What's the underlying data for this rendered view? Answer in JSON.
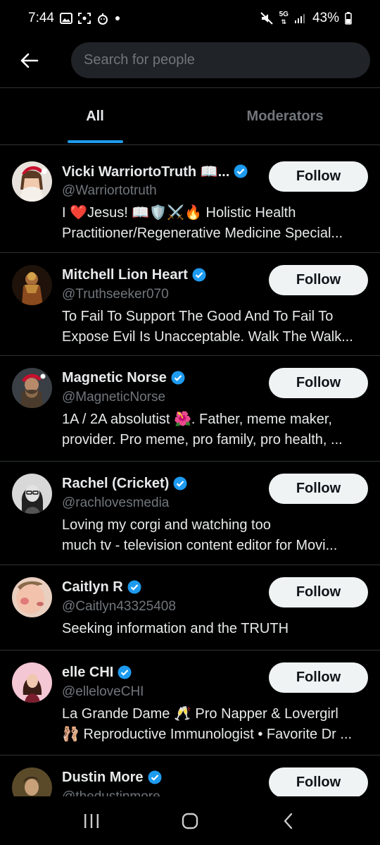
{
  "status_bar": {
    "time": "7:44",
    "network": "5G",
    "battery": "43%"
  },
  "search": {
    "placeholder": "Search for people"
  },
  "tabs": [
    {
      "label": "All"
    },
    {
      "label": "Moderators"
    }
  ],
  "colors": {
    "accent": "#1d9bf0",
    "background": "#000000",
    "secondary_text": "#71767b",
    "follow_button_bg": "#eff3f4"
  },
  "users": [
    {
      "name": "Vicki WarriortoTruth 📖...",
      "handle": "@Warriortotruth",
      "bio_line1": "I ❤️Jesus! 📖🛡️⚔️🔥 Holistic Health",
      "bio_line2": "Practitioner/Regenerative Medicine Special...",
      "follow_label": "Follow",
      "verified": true
    },
    {
      "name": "Mitchell Lion Heart",
      "handle": "@Truthseeker070",
      "bio_line1": "To Fail To Support The Good And To Fail To",
      "bio_line2": "Expose Evil Is Unacceptable. Walk The Walk...",
      "follow_label": "Follow",
      "verified": true
    },
    {
      "name": "Magnetic Norse",
      "handle": "@MagneticNorse",
      "bio_line1": "1A / 2A absolutist 🌺. Father, meme maker,",
      "bio_line2": "provider. Pro meme, pro family, pro health, ...",
      "follow_label": "Follow",
      "verified": true
    },
    {
      "name": "Rachel (Cricket)",
      "handle": "@rachlovesmedia",
      "bio_line1": "Loving my corgi and watching too",
      "bio_line2": "much tv - television content editor for Movi...",
      "follow_label": "Follow",
      "verified": true
    },
    {
      "name": "Caitlyn R",
      "handle": "@Caitlyn43325408",
      "bio_line1": "Seeking information and the TRUTH",
      "bio_line2": "",
      "follow_label": "Follow",
      "verified": true
    },
    {
      "name": "elle CHI",
      "handle": "@elleloveCHI",
      "bio_line1": "La Grande Dame 🥂 Pro Napper & Lovergirl",
      "bio_line2": "🩰 Reproductive Immunologist • Favorite Dr ...",
      "follow_label": "Follow",
      "verified": true
    },
    {
      "name": "Dustin More",
      "handle": "@thedustinmore",
      "bio_line1": "",
      "bio_line2": "",
      "follow_label": "Follow",
      "verified": true
    }
  ]
}
